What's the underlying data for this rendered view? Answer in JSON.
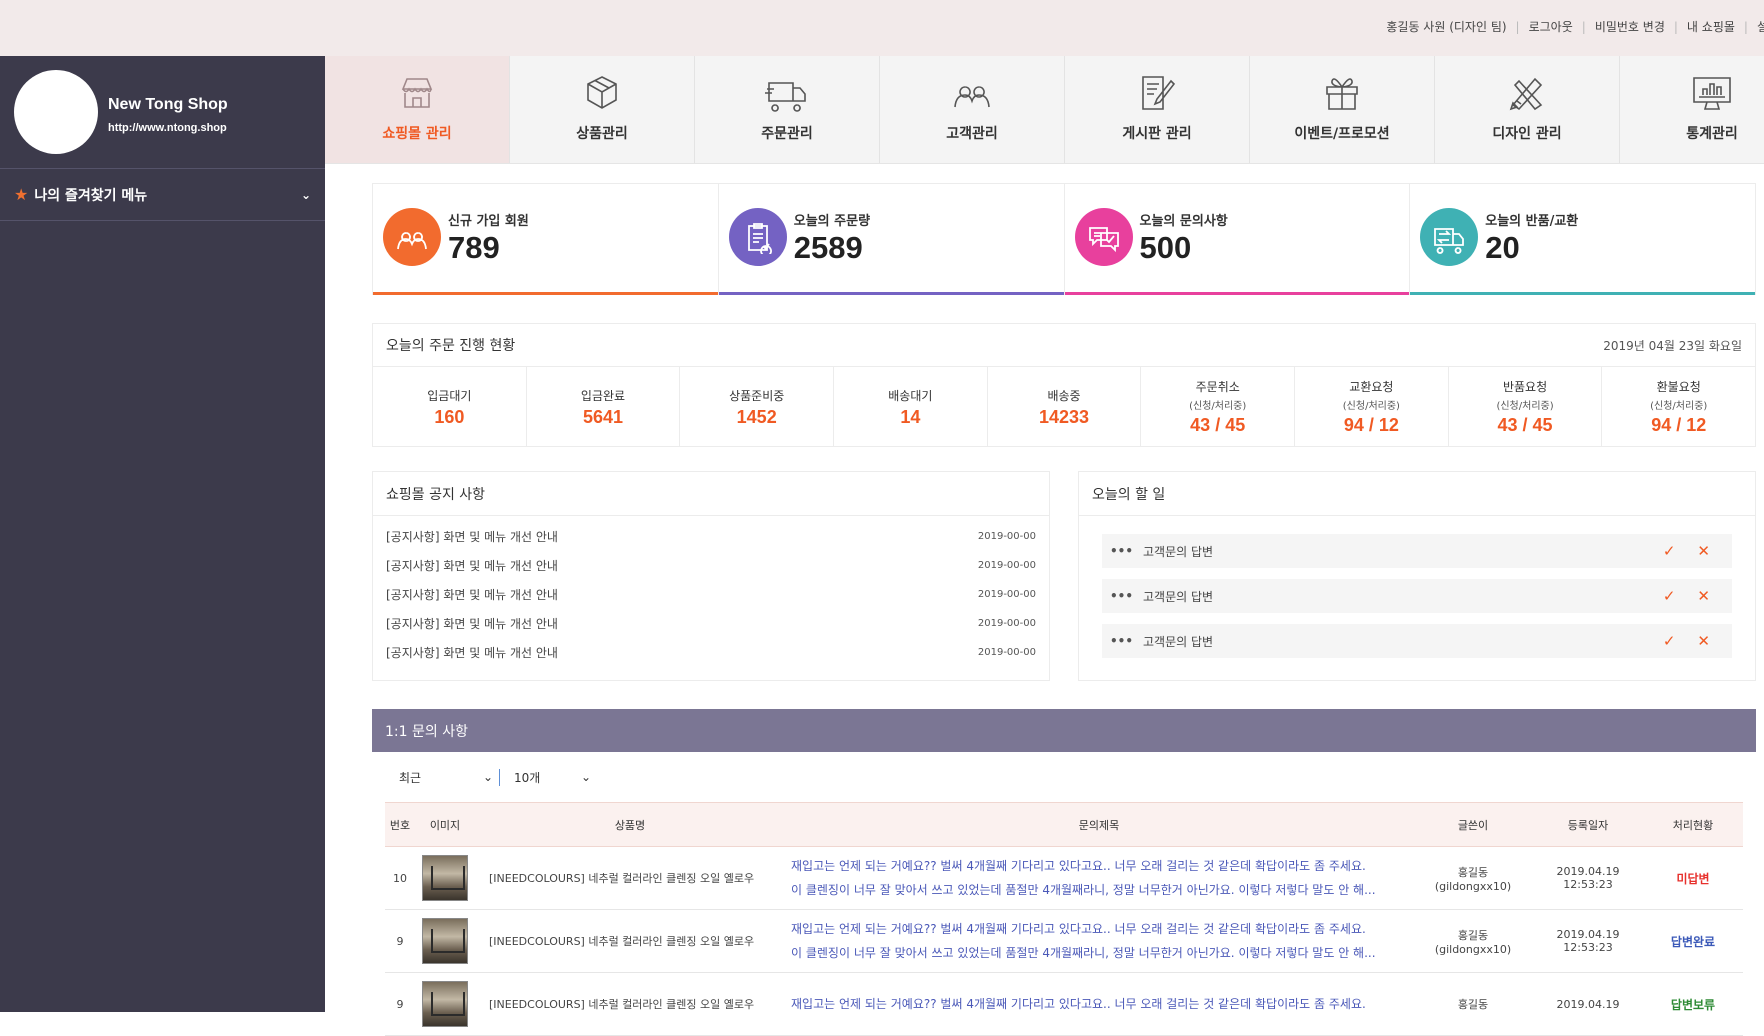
{
  "topbar": {
    "user": "홍길동 사원 (디자인 팀)",
    "logout": "로그아웃",
    "change_password": "비밀번호 변경",
    "my_shop": "내 쇼핑몰",
    "cut_link": "설"
  },
  "sidebar": {
    "shop_name": "New Tong Shop",
    "shop_url": "http://www.ntong.shop",
    "favorites_label": "나의 즐겨찾기 메뉴"
  },
  "nav": {
    "items": [
      {
        "label": "쇼핑몰 관리",
        "icon": "store-icon",
        "active": true
      },
      {
        "label": "상품관리",
        "icon": "box-icon"
      },
      {
        "label": "주문관리",
        "icon": "truck-icon"
      },
      {
        "label": "고객관리",
        "icon": "customers-icon"
      },
      {
        "label": "게시판 관리",
        "icon": "board-edit-icon"
      },
      {
        "label": "이벤트/프로모션",
        "icon": "gift-icon"
      },
      {
        "label": "디자인 관리",
        "icon": "design-tools-icon"
      },
      {
        "label": "통계관리",
        "icon": "monitor-chart-icon"
      }
    ]
  },
  "stats": [
    {
      "label": "신규 가입 회원",
      "value": "789",
      "color": "#f26b2e",
      "icon": "members-icon"
    },
    {
      "label": "오늘의 주문량",
      "value": "2589",
      "color": "#7462c3",
      "icon": "clipboard-icon"
    },
    {
      "label": "오늘의 문의사항",
      "value": "500",
      "color": "#e8409d",
      "icon": "chat-icon"
    },
    {
      "label": "오늘의 반품/교환",
      "value": "20",
      "color": "#3fb1b4",
      "icon": "return-truck-icon"
    }
  ],
  "orders": {
    "title": "오늘의 주문 진행 현황",
    "date": "2019년 04월 23일 화요일",
    "cells": [
      {
        "label": "입금대기",
        "sub": "",
        "value": "160"
      },
      {
        "label": "입금완료",
        "sub": "",
        "value": "5641"
      },
      {
        "label": "상품준비중",
        "sub": "",
        "value": "1452"
      },
      {
        "label": "배송대기",
        "sub": "",
        "value": "14"
      },
      {
        "label": "배송중",
        "sub": "",
        "value": "14233"
      },
      {
        "label": "주문취소",
        "sub": "(신청/처리중)",
        "value": "43 / 45"
      },
      {
        "label": "교환요청",
        "sub": "(신청/처리중)",
        "value": "94 / 12"
      },
      {
        "label": "반품요청",
        "sub": "(신청/처리중)",
        "value": "43 / 45"
      },
      {
        "label": "환불요청",
        "sub": "(신청/처리중)",
        "value": "94 / 12"
      }
    ]
  },
  "notice": {
    "title": "쇼핑몰 공지 사항",
    "items": [
      {
        "text": "[공지사항] 화면 및 메뉴 개선 안내",
        "date": "2019-00-00"
      },
      {
        "text": "[공지사항] 화면 및 메뉴 개선 안내",
        "date": "2019-00-00"
      },
      {
        "text": "[공지사항] 화면 및 메뉴 개선 안내",
        "date": "2019-00-00"
      },
      {
        "text": "[공지사항] 화면 및 메뉴 개선 안내",
        "date": "2019-00-00"
      },
      {
        "text": "[공지사항] 화면 및 메뉴 개선 안내",
        "date": "2019-00-00"
      }
    ]
  },
  "todo": {
    "title": "오늘의 할 일",
    "items": [
      {
        "text": "고객문의 답변"
      },
      {
        "text": "고객문의 답변"
      },
      {
        "text": "고객문의 답변"
      }
    ]
  },
  "qna": {
    "title": "1:1 문의 사항",
    "filter_sort": "최근",
    "filter_count": "10개",
    "headers": [
      "번호",
      "이미지",
      "상품명",
      "문의제목",
      "글쓴이",
      "등록일자",
      "처리현황"
    ],
    "rows": [
      {
        "no": "10",
        "product": "[INEEDCOLOURS] 네추럴 컬러라인 클렌징 오일 옐로우",
        "title1": "재입고는 언제 되는 거예요?? 벌써 4개월째 기다리고 있다고요.. 너무 오래 걸리는 것 같은데 확답이라도 좀 주세요.",
        "title2": "이 클렌징이 너무 잘 맞아서 쓰고 있었는데 품절만 4개월째라니, 정말 너무한거 아닌가요. 이렇다 저렇다 말도 안 해...",
        "writer1": "홍길동",
        "writer2": "(gildongxx10)",
        "date1": "2019.04.19",
        "date2": "12:53:23",
        "status": "미답변",
        "status_class": "st-red"
      },
      {
        "no": "9",
        "product": "[INEEDCOLOURS] 네추럴 컬러라인 클렌징 오일 옐로우",
        "title1": "재입고는 언제 되는 거예요?? 벌써 4개월째 기다리고 있다고요.. 너무 오래 걸리는 것 같은데 확답이라도 좀 주세요.",
        "title2": "이 클렌징이 너무 잘 맞아서 쓰고 있었는데 품절만 4개월째라니, 정말 너무한거 아닌가요. 이렇다 저렇다 말도 안 해...",
        "writer1": "홍길동",
        "writer2": "(gildongxx10)",
        "date1": "2019.04.19",
        "date2": "12:53:23",
        "status": "답변완료",
        "status_class": "st-blue"
      },
      {
        "no": "9",
        "product": "[INEEDCOLOURS] 네추럴 컬러라인 클렌징 오일 옐로우",
        "title1": "재입고는 언제 되는 거예요?? 벌써 4개월째 기다리고 있다고요.. 너무 오래 걸리는 것 같은데 확답이라도 좀 주세요.",
        "title2": "",
        "writer1": "홍길동",
        "writer2": "",
        "date1": "2019.04.19",
        "date2": "",
        "status": "답변보류",
        "status_class": "st-green"
      }
    ]
  }
}
